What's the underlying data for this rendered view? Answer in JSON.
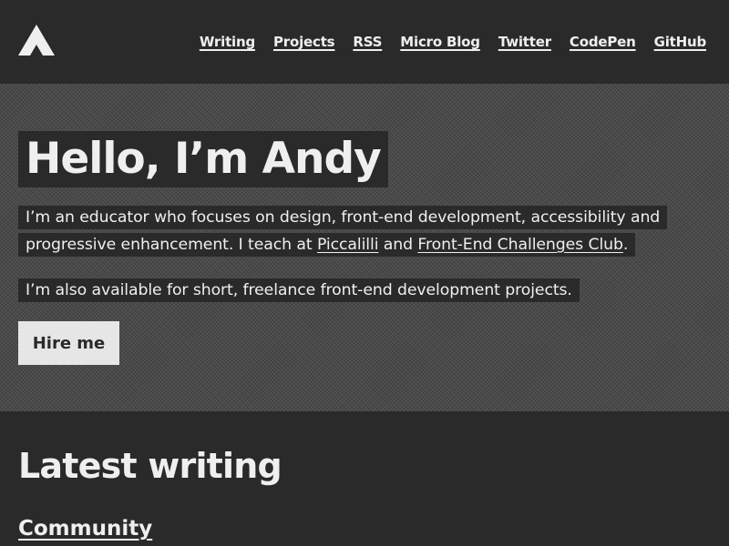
{
  "header": {
    "logo_icon": "triangle-logo-icon",
    "nav": [
      {
        "label": "Writing"
      },
      {
        "label": "Projects"
      },
      {
        "label": "RSS"
      },
      {
        "label": "Micro Blog"
      },
      {
        "label": "Twitter"
      },
      {
        "label": "CodePen"
      },
      {
        "label": "GitHub"
      }
    ]
  },
  "hero": {
    "title": "Hello, I’m Andy",
    "intro_part1": "I’m an educator who focuses on design, front-end development, accessibility and progressive enhancement. I teach at ",
    "link_piccalilli": "Piccalilli",
    "intro_and": " and ",
    "link_frontend": "Front-End Challenges Club",
    "intro_end": ".",
    "available": "I’m also available for short, freelance front-end development projects.",
    "hire_label": "Hire me"
  },
  "latest": {
    "title": "Latest writing",
    "first_post": "Community"
  },
  "colors": {
    "background": "#2a2a2a",
    "text": "#efefef",
    "button_bg": "#e6e6e6"
  }
}
